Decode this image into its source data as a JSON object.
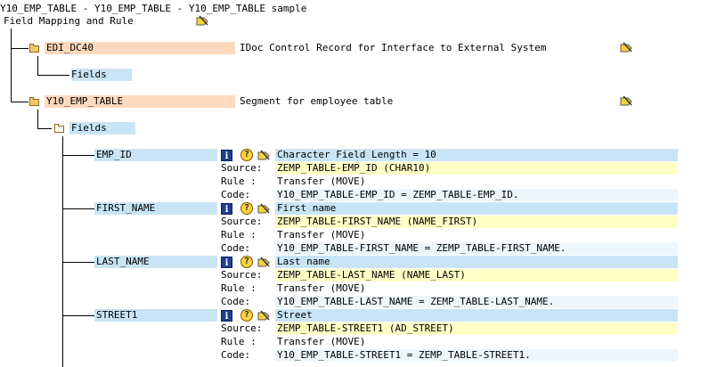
{
  "title": "Y10_EMP_TABLE - Y10_EMP_TABLE - Y10_EMP_TABLE sample",
  "root_label": "Field Mapping and Rule",
  "segments": [
    {
      "name": "EDI_DC40",
      "desc": "IDoc Control Record for Interface to External System",
      "fields_label": "Fields"
    },
    {
      "name": "Y10_EMP_TABLE",
      "desc": "Segment for employee table",
      "fields_label": "Fields"
    }
  ],
  "labels": {
    "source": "Source:",
    "rule": "Rule :",
    "code": "Code:"
  },
  "fields": [
    {
      "name": "EMP_ID",
      "desc": "Character Field Length = 10",
      "source": "ZEMP_TABLE-EMP_ID (CHAR10)",
      "rule": "Transfer (MOVE)",
      "code": "Y10_EMP_TABLE-EMP_ID = ZEMP_TABLE-EMP_ID."
    },
    {
      "name": "FIRST_NAME",
      "desc": "First name",
      "source": "ZEMP_TABLE-FIRST_NAME (NAME_FIRST)",
      "rule": "Transfer (MOVE)",
      "code": "Y10_EMP_TABLE-FIRST_NAME = ZEMP_TABLE-FIRST_NAME."
    },
    {
      "name": "LAST_NAME",
      "desc": "Last name",
      "source": "ZEMP_TABLE-LAST_NAME (NAME_LAST)",
      "rule": "Transfer (MOVE)",
      "code": "Y10_EMP_TABLE-LAST_NAME = ZEMP_TABLE-LAST_NAME."
    },
    {
      "name": "STREET1",
      "desc": "Street",
      "source": "ZEMP_TABLE-STREET1 (AD_STREET)",
      "rule": "Transfer (MOVE)",
      "code": "Y10_EMP_TABLE-STREET1 = ZEMP_TABLE-STREET1."
    }
  ],
  "icons": {
    "info": "i",
    "help": "?",
    "edit": "pencil-icon"
  },
  "colors": {
    "segment_bg": "#ffd9bd",
    "field_bg": "#c9e5f5",
    "source_bg": "#ffffc6"
  }
}
